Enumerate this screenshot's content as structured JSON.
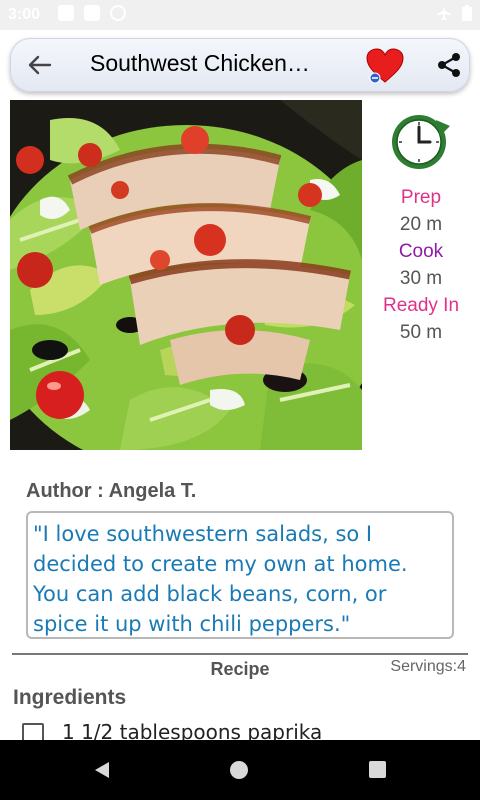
{
  "status_bar": {
    "time": "3:00",
    "icons_left": [
      "message-icon",
      "sd-card-icon",
      "sync-icon"
    ],
    "icons_right": [
      "airplane-icon",
      "battery-icon"
    ]
  },
  "toolbar": {
    "title": "Southwest Chicken…",
    "back_icon": "arrow-back-icon",
    "favorite_icon": "heart-favorite-icon",
    "share_icon": "share-icon"
  },
  "recipe": {
    "image_alt": "Southwest chicken salad photo",
    "prep_label": "Prep",
    "prep_value": "20 m",
    "cook_label": "Cook",
    "cook_value": "30 m",
    "ready_label": "Ready In",
    "ready_value": "50 m",
    "author": "Author : Angela T.",
    "description": "\"I love southwestern salads, so I decided to create my own at home. You can add black beans, corn, or spice it up with chili peppers.\"",
    "section_title": "Recipe",
    "servings": "Servings:4",
    "ingredients_heading": "Ingredients",
    "ingredients": [
      "1 1/2 tablespoons paprika"
    ]
  },
  "colors": {
    "prep": "#e0318a",
    "cook": "#8e1ba8",
    "ready": "#e0318a",
    "quote_text": "#1a7ab5",
    "clock_green": "#2e7d32"
  },
  "nav_bar": {
    "icons": [
      "nav-back-icon",
      "nav-home-icon",
      "nav-recent-icon"
    ]
  }
}
